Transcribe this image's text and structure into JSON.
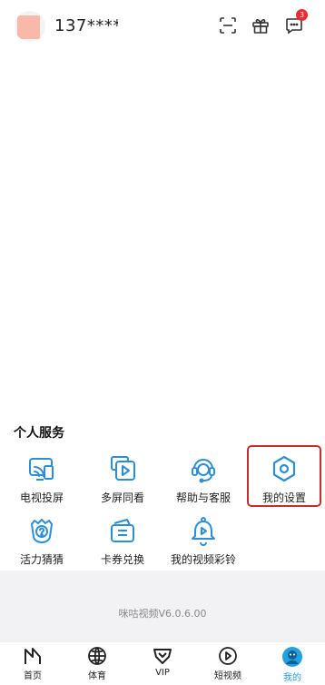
{
  "header": {
    "username": "137****",
    "message_badge": "3"
  },
  "services": {
    "title": "个人服务",
    "items": [
      {
        "label": "电视投屏",
        "icon": "tv-cast-icon"
      },
      {
        "label": "多屏同看",
        "icon": "multi-screen-icon"
      },
      {
        "label": "帮助与客服",
        "icon": "customer-service-icon"
      },
      {
        "label": "我的设置",
        "icon": "settings-icon"
      },
      {
        "label": "活力猜猜",
        "icon": "guess-icon"
      },
      {
        "label": "卡券兑换",
        "icon": "coupon-icon"
      },
      {
        "label": "我的视频彩铃",
        "icon": "video-ringtone-icon"
      }
    ]
  },
  "footer": {
    "version": "咪咕视频V6.0.6.00"
  },
  "tabbar": {
    "items": [
      {
        "label": "首页",
        "icon": "home-icon"
      },
      {
        "label": "体育",
        "icon": "sports-ball-icon"
      },
      {
        "label": "VIP",
        "icon": "vip-icon"
      },
      {
        "label": "短视频",
        "icon": "short-video-icon"
      },
      {
        "label": "我的",
        "icon": "profile-icon"
      }
    ],
    "active": "我的"
  },
  "colors": {
    "accent": "#23a0e0",
    "icon_blue": "#2c8fd6",
    "highlight": "#cc2b2b",
    "badge": "#ea2b33"
  }
}
